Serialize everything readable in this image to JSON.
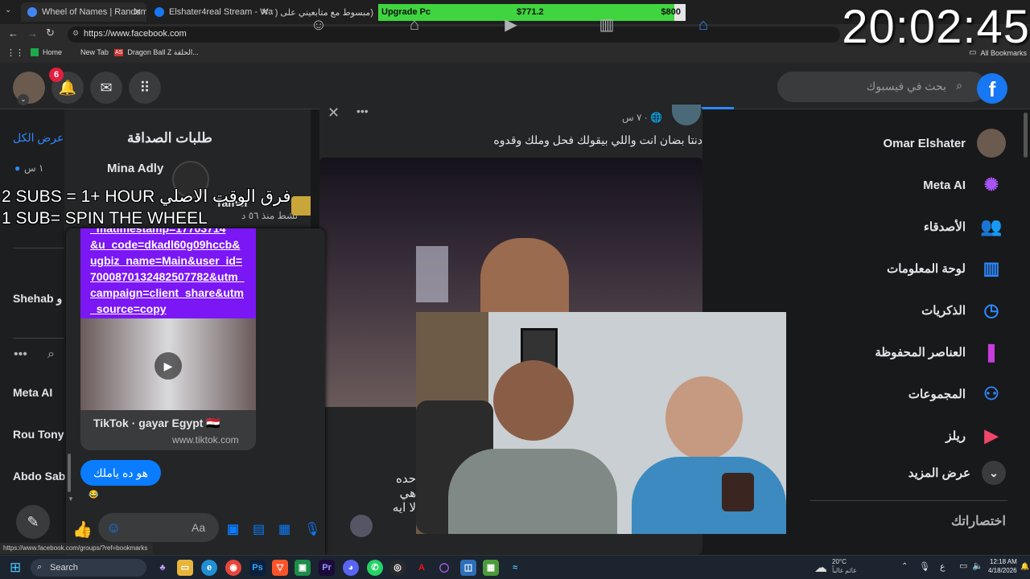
{
  "browser": {
    "tabs": [
      {
        "title": "Wheel of Names | Random name",
        "color": "#4285f4"
      },
      {
        "title": "Elshater4real Stream - Watch Li",
        "color": "#1877f2"
      },
      {
        "title": "(مبسوط مع متابعيني على (تيك",
        "color": "#111111"
      }
    ],
    "url": "https://www.facebook.com",
    "bookmarks": [
      "Home",
      "New Tab",
      "AS",
      "Dragon Ball Z الحلقة...",
      "All Bookmarks"
    ],
    "status_url": "https://www.facebook.com/groups/?ref=bookmarks"
  },
  "overlay": {
    "upgrade_label": "Upgrade Pc",
    "current_amount": "$771.2",
    "goal_amount": "$800",
    "progress_fraction": 0.964,
    "clock": "20:02:45",
    "sub_line_1": "2 SUBS = 1+ HOUR",
    "sub_line_1_ar": "فرق الوقت الاصلي",
    "sub_line_2": "1 SUB= SPIN THE WHEEL"
  },
  "fb": {
    "notifications_count": "6",
    "search_placeholder": "بحث في فيسبوك",
    "friend_requests": {
      "title": "طلبات الصداقة",
      "see_all": "عرض الكل",
      "request_name": "Mina Adly",
      "request_time": "١ س",
      "second_name": "Tamer",
      "second_status": "نشط منذ ٥٦ د"
    },
    "contacts": [
      "Shehab و",
      "Meta AI",
      "Rou Tony",
      "Abdo Sab"
    ],
    "post": {
      "time": "٧ س",
      "text": "دنتا بضان انت واللي بيقولك فحل وملك وقدوه",
      "comment_lines": [
        "حده",
        "هي",
        "لا ايه"
      ]
    },
    "chat": {
      "link_text": "&u_code=dkadl60g09hccb&ugbiz_name=Main&user_id=7000870132482507782&utm_campaign=client_share&utm_source=copy",
      "link_top": "_matimestamp=17703714",
      "preview_title": "TikTok · gayar Egypt 🇪🇬",
      "preview_domain": "www.tiktok.com",
      "bubble": "هو ده ياملك",
      "input_placeholder": "Aa"
    },
    "sidebar": [
      {
        "label": "Omar Elshater",
        "icon": "avatar"
      },
      {
        "label": "Meta AI",
        "icon": "meta-ai-icon"
      },
      {
        "label": "الأصدقاء",
        "icon": "friends-icon"
      },
      {
        "label": "لوحة المعلومات",
        "icon": "dashboard-icon"
      },
      {
        "label": "الذكريات",
        "icon": "memories-icon"
      },
      {
        "label": "العناصر المحفوظة",
        "icon": "saved-icon"
      },
      {
        "label": "المجموعات",
        "icon": "groups-icon"
      },
      {
        "label": "ريلز",
        "icon": "reels-icon"
      },
      {
        "label": "عرض المزيد",
        "icon": "chevron-down-icon"
      }
    ],
    "shortcuts_title": "اختصاراتك"
  },
  "taskbar": {
    "search": "Search",
    "weather_temp": "20°C",
    "weather_text": "غائم غالباً",
    "lang": "ع",
    "time": "12:18 AM",
    "date": "4/18/2026"
  }
}
